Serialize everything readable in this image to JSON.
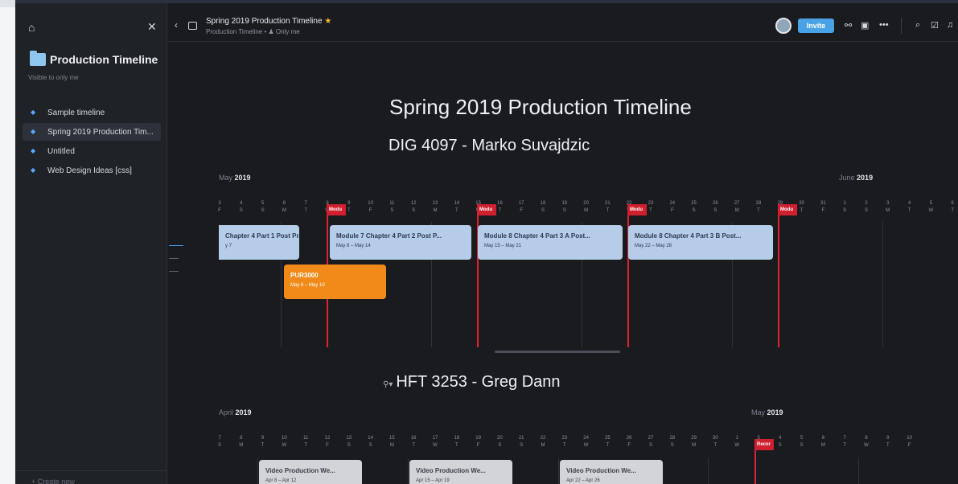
{
  "sidebar": {
    "title": "Production Timeline",
    "subtitle": "Visible to only me",
    "items": [
      {
        "label": "Sample timeline"
      },
      {
        "label": "Spring 2019 Production Tim..."
      },
      {
        "label": "Untitled"
      },
      {
        "label": "Web Design Ideas [css]"
      }
    ],
    "create_label": "Create new"
  },
  "header": {
    "title": "Spring 2019 Production Timeline",
    "breadcrumb": "Production Timeline",
    "visibility": "Only me",
    "invite_label": "Invite"
  },
  "page": {
    "title": "Spring 2019 Production Timeline",
    "section1": "DIG 4097 - Marko Suvajdzic",
    "section2": "HFT 3253 - Greg Dann"
  },
  "timeline1": {
    "month_left": "May",
    "month_left_year": "2019",
    "month_right": "June",
    "month_right_year": "2019",
    "days": [
      "3",
      "4",
      "5",
      "6",
      "7",
      "8",
      "9",
      "10",
      "11",
      "12",
      "13",
      "14",
      "15",
      "16",
      "17",
      "18",
      "19",
      "20",
      "21",
      "22",
      "23",
      "24",
      "25",
      "26",
      "27",
      "28",
      "29",
      "30",
      "31",
      "1",
      "2",
      "3",
      "4",
      "5",
      "6"
    ],
    "weekdays": [
      "F",
      "S",
      "S",
      "M",
      "T",
      "W",
      "T",
      "F",
      "S",
      "S",
      "M",
      "T",
      "W",
      "T",
      "F",
      "S",
      "S",
      "M",
      "T",
      "W",
      "T",
      "F",
      "S",
      "S",
      "M",
      "T",
      "W",
      "T",
      "F",
      "S",
      "S",
      "M",
      "T",
      "W",
      "T"
    ],
    "flags": [
      "Modu",
      "Modu",
      "Modu",
      "Modu"
    ],
    "bars": [
      {
        "title": "Chapter 4 Part 1 Post Pr...",
        "dates": "y 7"
      },
      {
        "title": "Module 7 Chapter 4 Part 2 Post P...",
        "dates": "May 8 – May 14"
      },
      {
        "title": "Module 8 Chapter 4 Part 3 A Post...",
        "dates": "May 15 – May 21"
      },
      {
        "title": "Module 8 Chapter 4 Part 3 B Post...",
        "dates": "May 22 – May 28"
      },
      {
        "title": "PUR3000",
        "dates": "May 6 – May 10"
      }
    ]
  },
  "timeline2": {
    "month_left": "April",
    "month_left_year": "2019",
    "month_right": "May",
    "month_right_year": "2019",
    "days": [
      "7",
      "8",
      "9",
      "10",
      "11",
      "12",
      "13",
      "14",
      "15",
      "16",
      "17",
      "18",
      "19",
      "20",
      "21",
      "22",
      "23",
      "24",
      "25",
      "26",
      "27",
      "28",
      "29",
      "30",
      "1",
      "3",
      "4",
      "5",
      "6",
      "7",
      "8",
      "9",
      "10"
    ],
    "weekdays": [
      "S",
      "M",
      "T",
      "W",
      "T",
      "F",
      "S",
      "S",
      "M",
      "T",
      "W",
      "T",
      "F",
      "S",
      "S",
      "M",
      "T",
      "W",
      "T",
      "F",
      "S",
      "S",
      "M",
      "T",
      "W",
      "F",
      "S",
      "S",
      "M",
      "T",
      "W",
      "T",
      "F"
    ],
    "flags": [
      "Recor"
    ],
    "bars": [
      {
        "title": "Video Production We...",
        "dates": "Apr 8 – Apr 12"
      },
      {
        "title": "Video Production We...",
        "dates": "Apr 15 – Apr 19"
      },
      {
        "title": "Video Production We...",
        "dates": "Apr 22 – Apr 26"
      }
    ]
  },
  "colors": {
    "accent": "#4aa2e6",
    "flag": "#d01f2f",
    "bar_blue": "#b5cde8",
    "bar_orange": "#f28a1a",
    "bar_grey": "#d2d4d8"
  }
}
